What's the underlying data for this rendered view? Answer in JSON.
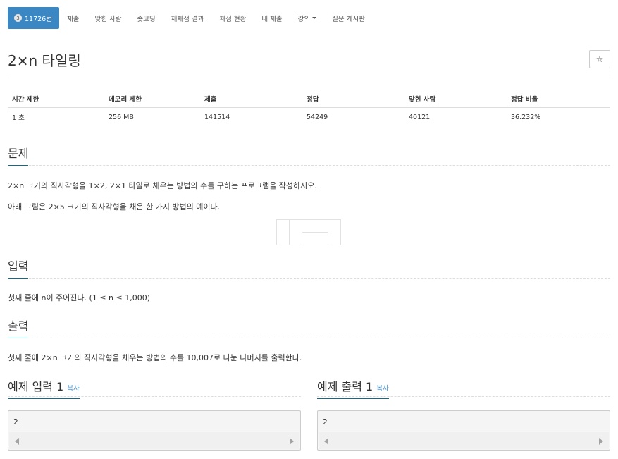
{
  "nav": {
    "problem_number": "11726번",
    "tabs": [
      "제출",
      "맞힌 사람",
      "숏코딩",
      "재채점 결과",
      "채점 현황",
      "내 제출",
      "강의",
      "질문 게시판"
    ]
  },
  "title": "2×n 타일링",
  "star_button": "☆",
  "info": {
    "headers": [
      "시간 제한",
      "메모리 제한",
      "제출",
      "정답",
      "맞힌 사람",
      "정답 비율"
    ],
    "values": [
      "1 초",
      "256 MB",
      "141514",
      "54249",
      "40121",
      "36.232%"
    ]
  },
  "problem": {
    "heading": "문제",
    "line1": "2×n 크기의 직사각형을 1×2, 2×1 타일로 채우는 방법의 수를 구하는 프로그램을 작성하시오.",
    "line2": "아래 그림은 2×5 크기의 직사각형을 채운 한 가지 방법의 예이다."
  },
  "input": {
    "heading": "입력",
    "text": "첫째 줄에 n이 주어진다. (1 ≤ n ≤ 1,000)"
  },
  "output": {
    "heading": "출력",
    "text": "첫째 줄에 2×n 크기의 직사각형을 채우는 방법의 수를 10,007로 나눈 나머지를 출력한다."
  },
  "sample_input": {
    "heading": "예제 입력 1",
    "copy": "복사",
    "value": "2"
  },
  "sample_output": {
    "heading": "예제 출력 1",
    "copy": "복사",
    "value": "2"
  }
}
